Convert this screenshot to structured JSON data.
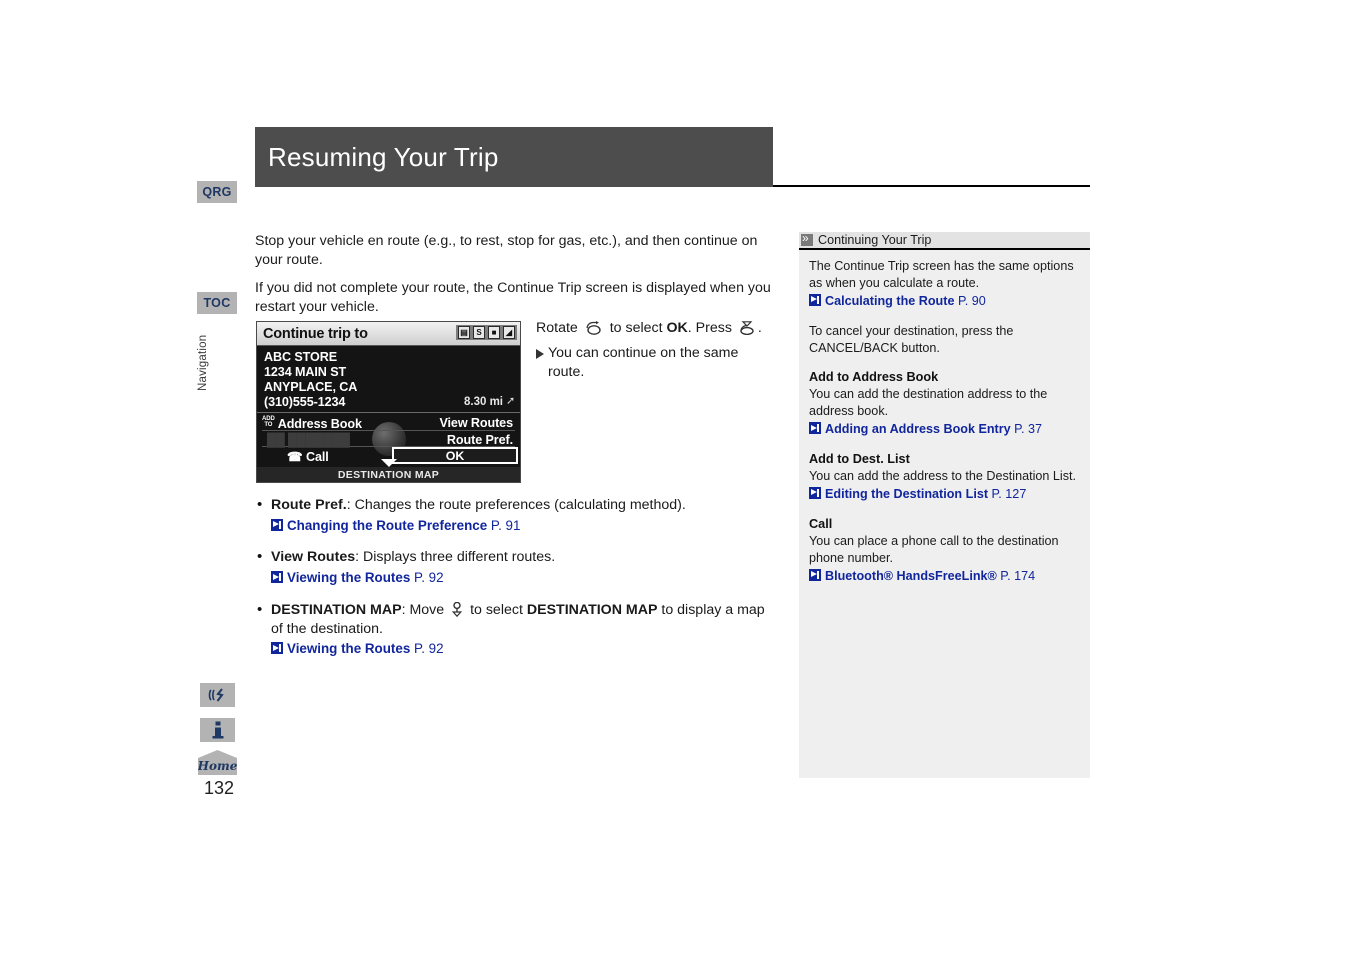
{
  "page": {
    "number": "132",
    "section_label": "Navigation",
    "title": "Resuming Your Trip"
  },
  "margin_tabs": {
    "qrg": "QRG",
    "toc": "TOC",
    "voice_icon": "voice-command-icon",
    "info_icon": "info-icon",
    "home": "Home"
  },
  "main": {
    "paragraphs": [
      "Stop your vehicle en route (e.g., to rest, stop for gas, etc.), and then continue on your route.",
      "If you did not complete your route, the Continue Trip screen is displayed when you restart your vehicle."
    ],
    "instruction": {
      "line1_a": "Rotate",
      "line1_b": "to select",
      "line1_ok": "OK",
      "line1_c": ". Press",
      "line1_d": ".",
      "line2": "You can continue on the same route."
    },
    "bullets": [
      {
        "term": "Route Pref.",
        "rest": ": Changes the route preferences (calculating method).",
        "ref_label": "Changing the Route Preference",
        "ref_page": "P. 91"
      },
      {
        "term": "View Routes",
        "rest": ": Displays three different routes.",
        "ref_label": "Viewing the Routes",
        "ref_page": "P. 92"
      },
      {
        "term": "DESTINATION MAP",
        "rest_a": ": Move",
        "rest_b": "to select",
        "rest_bold": "DESTINATION MAP",
        "rest_c": "to display a map of the destination.",
        "ref_label": "Viewing the Routes",
        "ref_page": "P. 92"
      }
    ]
  },
  "nav_screen": {
    "title": "Continue trip to",
    "status_icons": [
      "traffic-icon",
      "fuel-icon",
      "screen-icon",
      "map-icon"
    ],
    "destination": {
      "name": "ABC STORE",
      "street": "1234 MAIN ST",
      "city_state": "ANYPLACE, CA",
      "phone": "(310)555-1234",
      "distance": "8.30 mi"
    },
    "menu": {
      "add_to_prefix": "ADD TO",
      "address_book": "Address Book",
      "disabled_row": "",
      "call": "Call",
      "view_routes": "View Routes",
      "route_pref": "Route Pref.",
      "ok": "OK"
    },
    "footer": "DESTINATION MAP"
  },
  "sidebar": {
    "header": "Continuing Your Trip",
    "blocks": [
      {
        "text": "The Continue Trip screen has the same options as when you calculate a route.",
        "ref_label": "Calculating the Route",
        "ref_page": "P. 90"
      },
      {
        "text": "To cancel your destination, press the CANCEL/BACK button."
      },
      {
        "heading": "Add to Address Book",
        "text": "You can add the destination address to the address book.",
        "ref_label": "Adding an Address Book Entry",
        "ref_page": "P. 37"
      },
      {
        "heading": "Add to Dest. List",
        "text": "You can add the address to the Destination List.",
        "ref_label": "Editing the Destination List",
        "ref_page": "P. 127"
      },
      {
        "heading": "Call",
        "text": "You can place a phone call to the destination phone number.",
        "ref_label": "Bluetooth® HandsFreeLink®",
        "ref_page": "P. 174"
      }
    ]
  },
  "colors": {
    "header_bar": "#4d4d4d",
    "link": "#11269c",
    "tab_bg": "#b3b3b3",
    "tab_text": "#1f3864",
    "sidebar_bg": "#efefef"
  }
}
